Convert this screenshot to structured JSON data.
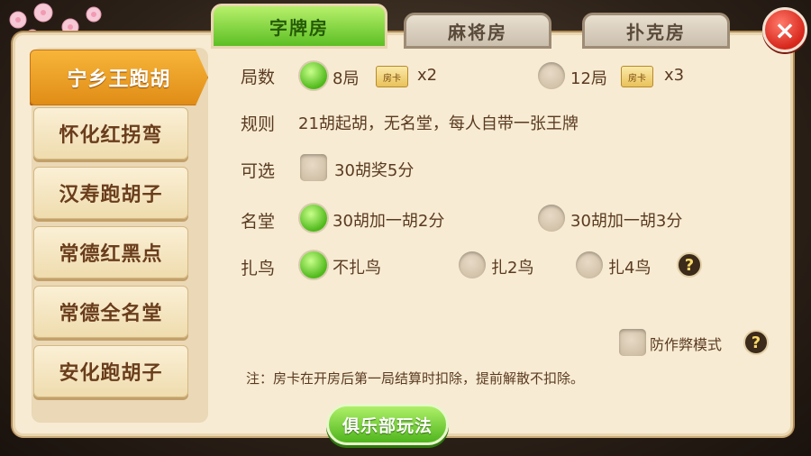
{
  "tabs": [
    {
      "label": "字牌房",
      "active": true
    },
    {
      "label": "麻将房",
      "active": false
    },
    {
      "label": "扑克房",
      "active": false
    }
  ],
  "close_icon": "×",
  "sidebar": {
    "items": [
      {
        "label": "宁乡王跑胡",
        "active": true
      },
      {
        "label": "怀化红拐弯",
        "active": false
      },
      {
        "label": "汉寿跑胡子",
        "active": false
      },
      {
        "label": "常德红黑点",
        "active": false
      },
      {
        "label": "常德全名堂",
        "active": false
      },
      {
        "label": "安化跑胡子",
        "active": false
      }
    ]
  },
  "rounds": {
    "label": "局数",
    "options": [
      {
        "label": "8局",
        "card": "房卡",
        "cost": "x2",
        "selected": true
      },
      {
        "label": "12局",
        "card": "房卡",
        "cost": "x3",
        "selected": false
      }
    ]
  },
  "rules": {
    "label": "规则",
    "text": "21胡起胡，无名堂，每人自带一张王牌"
  },
  "optional": {
    "label": "可选",
    "options": [
      {
        "label": "30胡奖5分",
        "checked": false
      }
    ]
  },
  "mingtang": {
    "label": "名堂",
    "options": [
      {
        "label": "30胡加一胡2分",
        "selected": true
      },
      {
        "label": "30胡加一胡3分",
        "selected": false
      }
    ]
  },
  "zhaniao": {
    "label": "扎鸟",
    "options": [
      {
        "label": "不扎鸟",
        "selected": true
      },
      {
        "label": "扎2鸟",
        "selected": false
      },
      {
        "label": "扎4鸟",
        "selected": false
      }
    ],
    "help": "?"
  },
  "anticheat": {
    "label": "防作弊模式",
    "checked": false,
    "help": "?"
  },
  "note": "注：房卡在开房后第一局结算时扣除，提前解散不扣除。",
  "club_button": "俱乐部玩法",
  "colors": {
    "accent_green": "#5cbf24",
    "accent_orange": "#e08d16",
    "close_red": "#d7261b"
  }
}
